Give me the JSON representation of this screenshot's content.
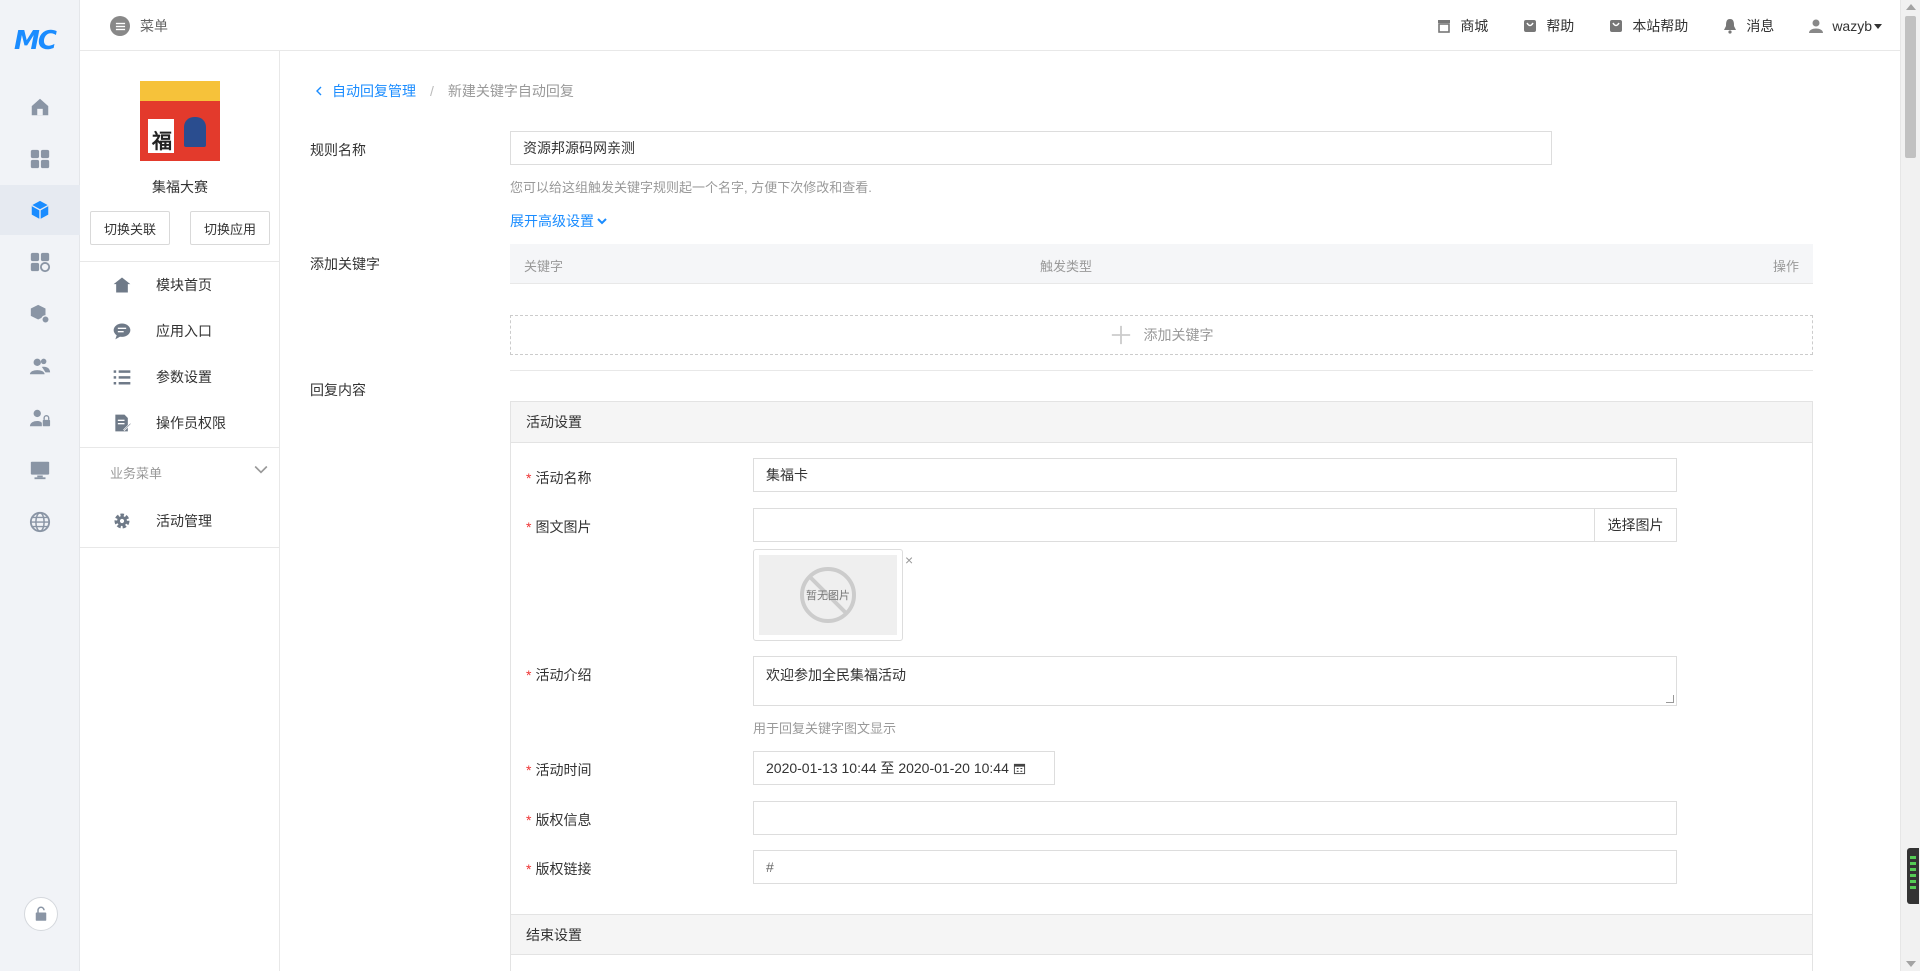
{
  "logo": "MC",
  "topbar": {
    "menu_label": "菜单",
    "items": [
      {
        "label": "商城",
        "icon": "store-icon"
      },
      {
        "label": "帮助",
        "icon": "help-bag-icon"
      },
      {
        "label": "本站帮助",
        "icon": "site-help-icon"
      },
      {
        "label": "消息",
        "icon": "bell-icon"
      },
      {
        "label": "wazyb",
        "icon": "user-icon"
      }
    ]
  },
  "rail": {
    "items": [
      {
        "name": "home-icon",
        "active": false
      },
      {
        "name": "apps-grid-icon",
        "active": false
      },
      {
        "name": "cube-icon",
        "active": true
      },
      {
        "name": "module-settings-icon",
        "active": false
      },
      {
        "name": "package-gear-icon",
        "active": false
      },
      {
        "name": "users-icon",
        "active": false
      },
      {
        "name": "user-lock-icon",
        "active": false
      },
      {
        "name": "monitor-icon",
        "active": false
      },
      {
        "name": "globe-icon",
        "active": false
      }
    ],
    "bottom_icon": "lock-icon"
  },
  "sidebar": {
    "module_name": "集福大赛",
    "avatar_char": "福",
    "btn_switch_link": "切换关联",
    "btn_switch_app": "切换应用",
    "nav": [
      {
        "label": "模块首页",
        "icon": "home-icon"
      },
      {
        "label": "应用入口",
        "icon": "chat-icon"
      },
      {
        "label": "参数设置",
        "icon": "list-icon"
      },
      {
        "label": "操作员权限",
        "icon": "doc-edit-icon"
      }
    ],
    "group_label": "业务菜单",
    "group_items": [
      {
        "label": "活动管理",
        "icon": "gear-icon"
      }
    ]
  },
  "breadcrumb": {
    "parent": "自动回复管理",
    "separator": "/",
    "current": "新建关键字自动回复"
  },
  "form": {
    "rule_name_label": "规则名称",
    "rule_name_value": "资源邦源码网亲测",
    "rule_name_help": "您可以给这组触发关键字规则起一个名字, 方便下次修改和查看.",
    "advanced_toggle": "展开高级设置",
    "keywords_label": "添加关键字",
    "kw_cols": {
      "keyword": "关键字",
      "type": "触发类型",
      "action": "操作"
    },
    "kw_add": "添加关键字",
    "reply_label": "回复内容"
  },
  "activity": {
    "section_title": "活动设置",
    "name_label": "活动名称",
    "name_value": "集福卡",
    "image_label": "图文图片",
    "image_value": "",
    "pick_image": "选择图片",
    "no_image": "暂无图片",
    "remove": "×",
    "intro_label": "活动介绍",
    "intro_value": "欢迎参加全民集福活动",
    "intro_help": "用于回复关键字图文显示",
    "time_label": "活动时间",
    "time_value": "2020-01-13 10:44 至 2020-01-20 10:44",
    "copyright_label": "版权信息",
    "copyright_value": "",
    "link_label": "版权链接",
    "link_value": "#",
    "required_mark": "*"
  },
  "end_section_title": "结束设置"
}
